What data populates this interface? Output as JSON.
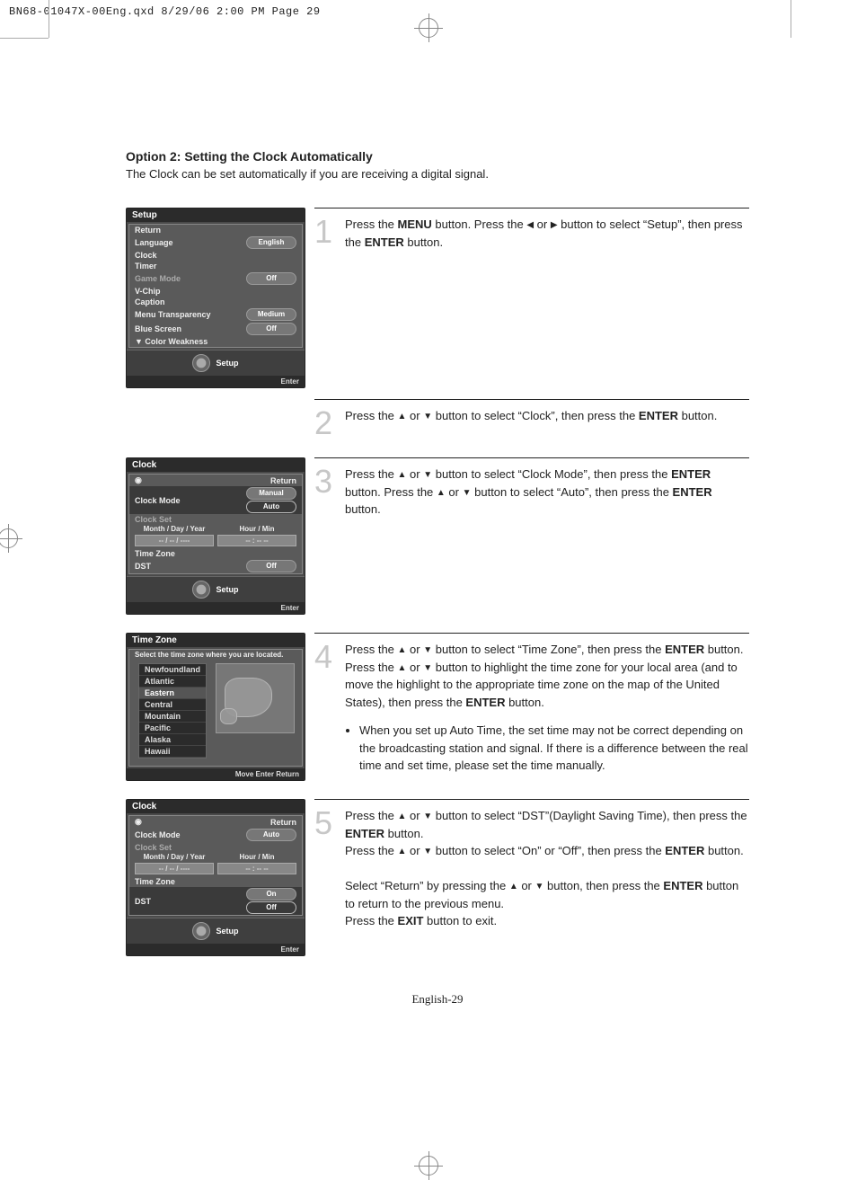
{
  "slug": "BN68-01047X-00Eng.qxd  8/29/06  2:00 PM  Page 29",
  "heading": "Option 2: Setting the Clock Automatically",
  "intro": "The Clock can be set automatically if you are receiving a digital signal.",
  "osd1": {
    "title": "Setup",
    "return": "Return",
    "rows": [
      {
        "label": "Language",
        "value": "English"
      },
      {
        "label": "Clock",
        "value": ""
      },
      {
        "label": "Timer",
        "value": ""
      },
      {
        "label": "Game Mode",
        "value": "Off",
        "dim": true
      },
      {
        "label": "V-Chip",
        "value": ""
      },
      {
        "label": "Caption",
        "value": ""
      },
      {
        "label": "Menu Transparency",
        "value": "Medium"
      },
      {
        "label": "Blue Screen",
        "value": "Off"
      },
      {
        "label": "▼ Color Weakness",
        "value": ""
      }
    ],
    "footer": "Setup",
    "enter": "Enter"
  },
  "osd2": {
    "title": "Clock",
    "return": "Return",
    "clock_mode": "Clock Mode",
    "clock_set": "Clock Set",
    "manual": "Manual",
    "auto": "Auto",
    "mdy": "Month / Day / Year",
    "hm": "Hour / Min",
    "mdy_val": "-- / -- / ----",
    "hm_val": "-- : --    --",
    "time_zone": "Time Zone",
    "dst": "DST",
    "dst_val": "Off",
    "footer": "Setup",
    "enter": "Enter"
  },
  "osd3": {
    "title": "Time Zone",
    "prompt": "Select the time zone where you are located.",
    "zones": [
      "Newfoundland",
      "Atlantic",
      "Eastern",
      "Central",
      "Mountain",
      "Pacific",
      "Alaska",
      "Hawaii"
    ],
    "selected": "Eastern",
    "bottombar": "Move      Enter      Return"
  },
  "osd4": {
    "title": "Clock",
    "return": "Return",
    "clock_mode": "Clock Mode",
    "clock_set": "Clock Set",
    "auto": "Auto",
    "mdy": "Month / Day / Year",
    "hm": "Hour / Min",
    "mdy_val": "-- / -- / ----",
    "hm_val": "-- : --    --",
    "time_zone": "Time Zone",
    "dst": "DST",
    "on": "On",
    "off": "Off",
    "footer": "Setup",
    "enter": "Enter"
  },
  "step1_pre": "Press the ",
  "step1_b1": "MENU",
  "step1_mid1": " button. Press the  ",
  "step1_mid2": "  or  ",
  "step1_mid3": "  button to select “Setup”, then press the ",
  "step1_b2": "ENTER",
  "step1_end": " button.",
  "step2_pre": "Press the  ",
  "step2_mid1": "  or  ",
  "step2_mid2": "  button to select “Clock”, then press the ",
  "step2_b": "ENTER",
  "step2_end": " button.",
  "step3_pre": "Press the  ",
  "step3_mid1": "  or  ",
  "step3_mid2": "  button to select “Clock Mode”, then press the ",
  "step3_b1": "ENTER",
  "step3_mid3": " button. Press the  ",
  "step3_mid4": "  or  ",
  "step3_mid5": "  button to select “Auto”, then press the ",
  "step3_b2": "ENTER",
  "step3_end": " button.",
  "step4_pre": "Press the  ",
  "step4_mid1": "  or  ",
  "step4_mid2": "  button to select “Time Zone”, then press the ",
  "step4_b1": "ENTER",
  "step4_mid3": " button.",
  "step4_p2a": "Press the  ",
  "step4_p2b": "  or  ",
  "step4_p2c": "  button to highlight the time zone for your local area (and to move the highlight to the appropriate time zone on the map of the United States), then press the ",
  "step4_b2": "ENTER",
  "step4_p2d": " button.",
  "step4_note": "When you set up Auto Time, the set time may not be correct depending on the broadcasting station and signal. If there is a difference between the real time and set time, please set the time manually.",
  "step5_pre": "Press the  ",
  "step5_mid1": "  or  ",
  "step5_mid2": "  button to select “DST”(Daylight Saving Time), then press the ",
  "step5_b1": "ENTER",
  "step5_mid3": " button.",
  "step5_p2a": "Press the  ",
  "step5_p2b": "  or  ",
  "step5_p2c": "  button to select “On” or “Off”, then press the ",
  "step5_b2": "ENTER",
  "step5_p2d": " button.",
  "step5_p3a": "Select “Return” by pressing the  ",
  "step5_p3b": "  or  ",
  "step5_p3c": "  button, then press the ",
  "step5_b3": "ENTER",
  "step5_p3d": " button to return to the previous menu.",
  "step5_p4a": "Press the ",
  "step5_b4": "EXIT",
  "step5_p4b": " button to exit.",
  "page_number": "English-29"
}
